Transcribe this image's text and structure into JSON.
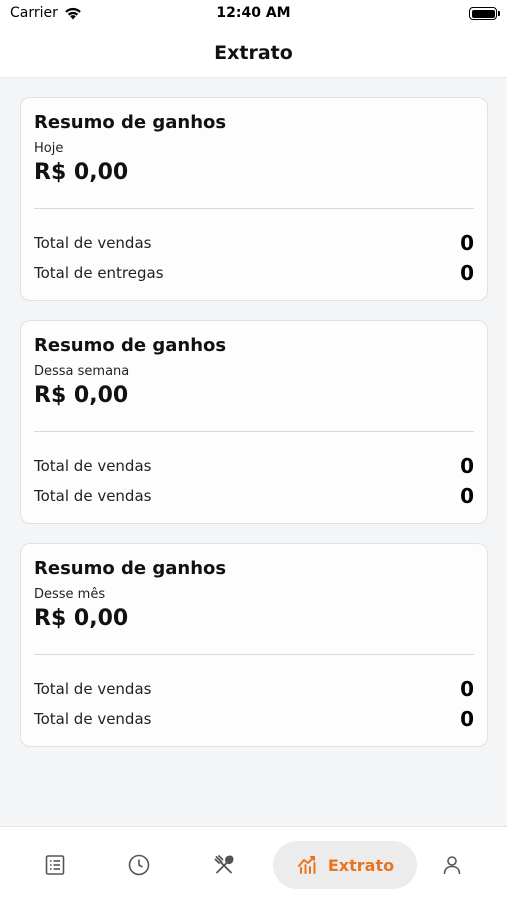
{
  "status_bar": {
    "carrier": "Carrier",
    "time": "12:40 AM"
  },
  "header": {
    "title": "Extrato"
  },
  "cards": [
    {
      "title": "Resumo de ganhos",
      "period": "Hoje",
      "amount": "R$ 0,00",
      "rows": [
        {
          "label": "Total de vendas",
          "value": "0"
        },
        {
          "label": "Total de entregas",
          "value": "0"
        }
      ]
    },
    {
      "title": "Resumo de ganhos",
      "period": "Dessa semana",
      "amount": "R$ 0,00",
      "rows": [
        {
          "label": "Total de vendas",
          "value": "0"
        },
        {
          "label": "Total de vendas",
          "value": "0"
        }
      ]
    },
    {
      "title": "Resumo de ganhos",
      "period": "Desse mês",
      "amount": "R$ 0,00",
      "rows": [
        {
          "label": "Total de vendas",
          "value": "0"
        },
        {
          "label": "Total de vendas",
          "value": "0"
        }
      ]
    }
  ],
  "tabbar": {
    "active_label": "Extrato",
    "accent_color": "#e8741f",
    "items": [
      "list-icon",
      "clock-icon",
      "utensils-icon",
      "chart-icon",
      "user-icon"
    ]
  }
}
